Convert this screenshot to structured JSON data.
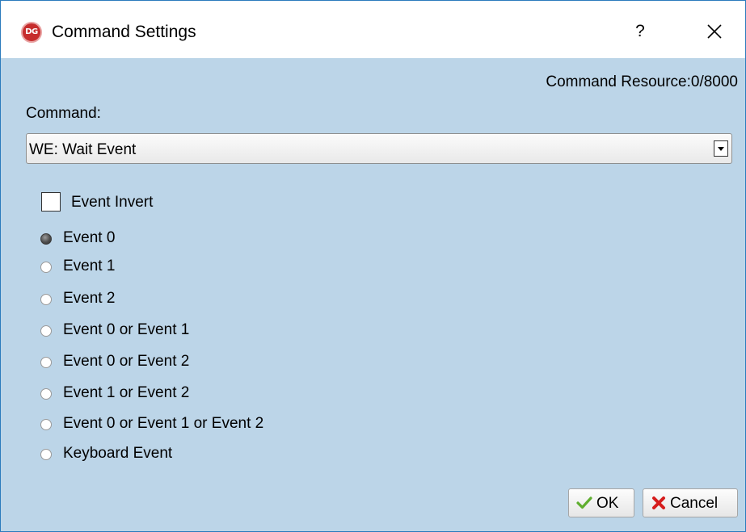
{
  "window": {
    "title": "Command Settings",
    "app_icon_text": "DG",
    "help_label": "?"
  },
  "resource": {
    "text": "Command Resource:0/8000"
  },
  "command": {
    "label": "Command:",
    "selected": "WE: Wait Event"
  },
  "options": {
    "invert_label": "Event Invert",
    "invert_checked": false,
    "selected_index": 0,
    "events": [
      "Event 0",
      "Event 1",
      "Event 2",
      "Event 0 or Event 1",
      "Event 0 or Event 2",
      "Event 1 or Event 2",
      "Event 0 or Event 1 or Event 2",
      "Keyboard Event"
    ]
  },
  "buttons": {
    "ok_label": "OK",
    "cancel_label": "Cancel"
  },
  "colors": {
    "dialog_background": "#bcd5e8",
    "title_background": "#ffffff",
    "window_border": "#2b7bbd",
    "ok_check": "#5fae2f",
    "cancel_x": "#d61d1d",
    "app_icon": "#c62d2d"
  }
}
